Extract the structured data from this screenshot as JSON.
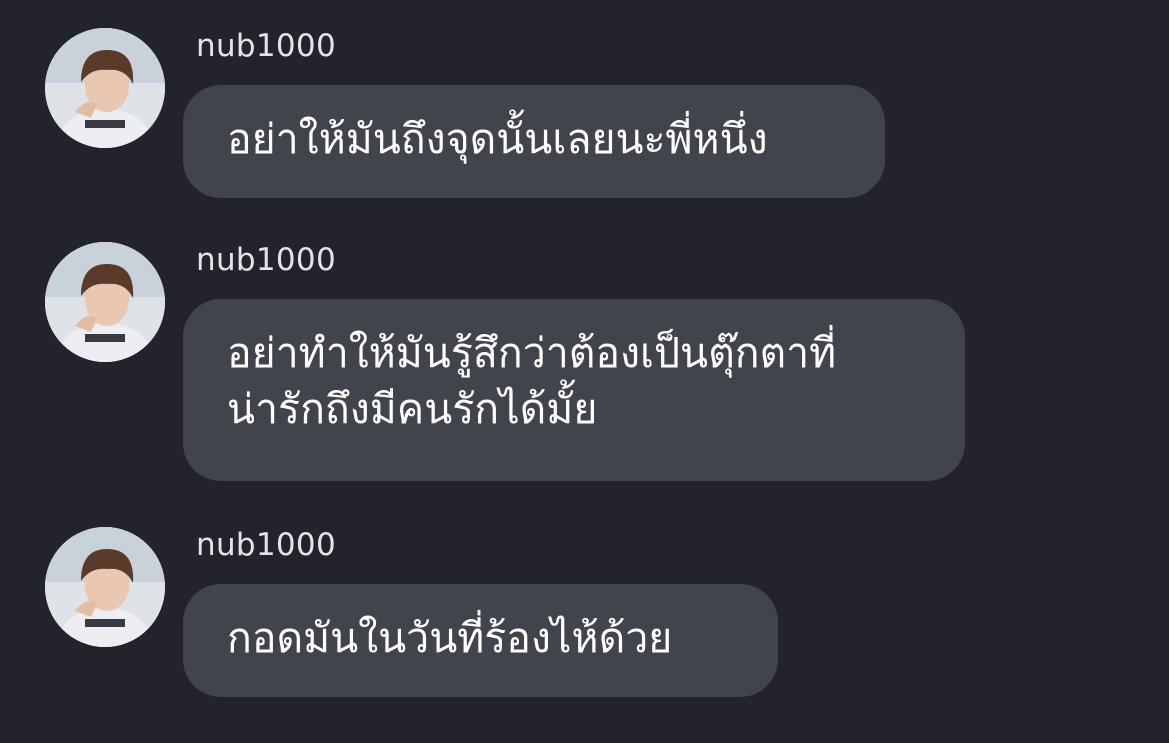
{
  "messages": [
    {
      "sender": "nub1000",
      "lines": [
        "อย่าให้มันถึงจุดนั้นเลยนะพี่หนึ่ง"
      ]
    },
    {
      "sender": "nub1000",
      "lines": [
        "อย่าทำให้มันรู้สึกว่าต้องเป็นตุ๊กตาที่",
        "น่ารักถึงมีคนรักได้มั้ย"
      ]
    },
    {
      "sender": "nub1000",
      "lines": [
        "กอดมันในวันที่ร้องไห้ด้วย"
      ]
    }
  ],
  "colors": {
    "background": "#22232b",
    "bubble": "#42444c",
    "text": "#ffffff",
    "sender_text": "#e4e4e8"
  }
}
